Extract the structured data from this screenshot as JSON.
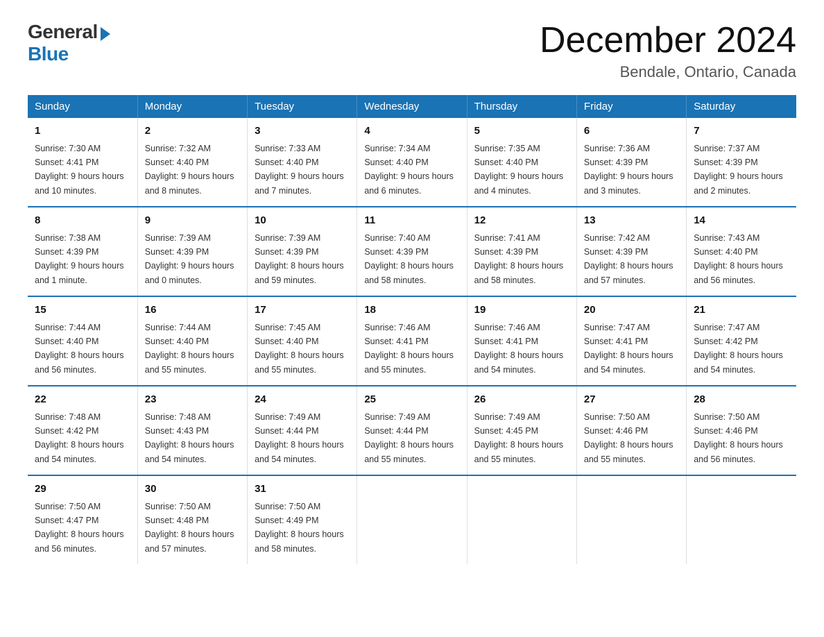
{
  "logo": {
    "general": "General",
    "blue": "Blue"
  },
  "title": "December 2024",
  "location": "Bendale, Ontario, Canada",
  "days_of_week": [
    "Sunday",
    "Monday",
    "Tuesday",
    "Wednesday",
    "Thursday",
    "Friday",
    "Saturday"
  ],
  "weeks": [
    [
      {
        "day": "1",
        "sunrise": "7:30 AM",
        "sunset": "4:41 PM",
        "daylight": "9 hours and 10 minutes."
      },
      {
        "day": "2",
        "sunrise": "7:32 AM",
        "sunset": "4:40 PM",
        "daylight": "9 hours and 8 minutes."
      },
      {
        "day": "3",
        "sunrise": "7:33 AM",
        "sunset": "4:40 PM",
        "daylight": "9 hours and 7 minutes."
      },
      {
        "day": "4",
        "sunrise": "7:34 AM",
        "sunset": "4:40 PM",
        "daylight": "9 hours and 6 minutes."
      },
      {
        "day": "5",
        "sunrise": "7:35 AM",
        "sunset": "4:40 PM",
        "daylight": "9 hours and 4 minutes."
      },
      {
        "day": "6",
        "sunrise": "7:36 AM",
        "sunset": "4:39 PM",
        "daylight": "9 hours and 3 minutes."
      },
      {
        "day": "7",
        "sunrise": "7:37 AM",
        "sunset": "4:39 PM",
        "daylight": "9 hours and 2 minutes."
      }
    ],
    [
      {
        "day": "8",
        "sunrise": "7:38 AM",
        "sunset": "4:39 PM",
        "daylight": "9 hours and 1 minute."
      },
      {
        "day": "9",
        "sunrise": "7:39 AM",
        "sunset": "4:39 PM",
        "daylight": "9 hours and 0 minutes."
      },
      {
        "day": "10",
        "sunrise": "7:39 AM",
        "sunset": "4:39 PM",
        "daylight": "8 hours and 59 minutes."
      },
      {
        "day": "11",
        "sunrise": "7:40 AM",
        "sunset": "4:39 PM",
        "daylight": "8 hours and 58 minutes."
      },
      {
        "day": "12",
        "sunrise": "7:41 AM",
        "sunset": "4:39 PM",
        "daylight": "8 hours and 58 minutes."
      },
      {
        "day": "13",
        "sunrise": "7:42 AM",
        "sunset": "4:39 PM",
        "daylight": "8 hours and 57 minutes."
      },
      {
        "day": "14",
        "sunrise": "7:43 AM",
        "sunset": "4:40 PM",
        "daylight": "8 hours and 56 minutes."
      }
    ],
    [
      {
        "day": "15",
        "sunrise": "7:44 AM",
        "sunset": "4:40 PM",
        "daylight": "8 hours and 56 minutes."
      },
      {
        "day": "16",
        "sunrise": "7:44 AM",
        "sunset": "4:40 PM",
        "daylight": "8 hours and 55 minutes."
      },
      {
        "day": "17",
        "sunrise": "7:45 AM",
        "sunset": "4:40 PM",
        "daylight": "8 hours and 55 minutes."
      },
      {
        "day": "18",
        "sunrise": "7:46 AM",
        "sunset": "4:41 PM",
        "daylight": "8 hours and 55 minutes."
      },
      {
        "day": "19",
        "sunrise": "7:46 AM",
        "sunset": "4:41 PM",
        "daylight": "8 hours and 54 minutes."
      },
      {
        "day": "20",
        "sunrise": "7:47 AM",
        "sunset": "4:41 PM",
        "daylight": "8 hours and 54 minutes."
      },
      {
        "day": "21",
        "sunrise": "7:47 AM",
        "sunset": "4:42 PM",
        "daylight": "8 hours and 54 minutes."
      }
    ],
    [
      {
        "day": "22",
        "sunrise": "7:48 AM",
        "sunset": "4:42 PM",
        "daylight": "8 hours and 54 minutes."
      },
      {
        "day": "23",
        "sunrise": "7:48 AM",
        "sunset": "4:43 PM",
        "daylight": "8 hours and 54 minutes."
      },
      {
        "day": "24",
        "sunrise": "7:49 AM",
        "sunset": "4:44 PM",
        "daylight": "8 hours and 54 minutes."
      },
      {
        "day": "25",
        "sunrise": "7:49 AM",
        "sunset": "4:44 PM",
        "daylight": "8 hours and 55 minutes."
      },
      {
        "day": "26",
        "sunrise": "7:49 AM",
        "sunset": "4:45 PM",
        "daylight": "8 hours and 55 minutes."
      },
      {
        "day": "27",
        "sunrise": "7:50 AM",
        "sunset": "4:46 PM",
        "daylight": "8 hours and 55 minutes."
      },
      {
        "day": "28",
        "sunrise": "7:50 AM",
        "sunset": "4:46 PM",
        "daylight": "8 hours and 56 minutes."
      }
    ],
    [
      {
        "day": "29",
        "sunrise": "7:50 AM",
        "sunset": "4:47 PM",
        "daylight": "8 hours and 56 minutes."
      },
      {
        "day": "30",
        "sunrise": "7:50 AM",
        "sunset": "4:48 PM",
        "daylight": "8 hours and 57 minutes."
      },
      {
        "day": "31",
        "sunrise": "7:50 AM",
        "sunset": "4:49 PM",
        "daylight": "8 hours and 58 minutes."
      },
      null,
      null,
      null,
      null
    ]
  ],
  "labels": {
    "sunrise": "Sunrise:",
    "sunset": "Sunset:",
    "daylight": "Daylight:"
  }
}
